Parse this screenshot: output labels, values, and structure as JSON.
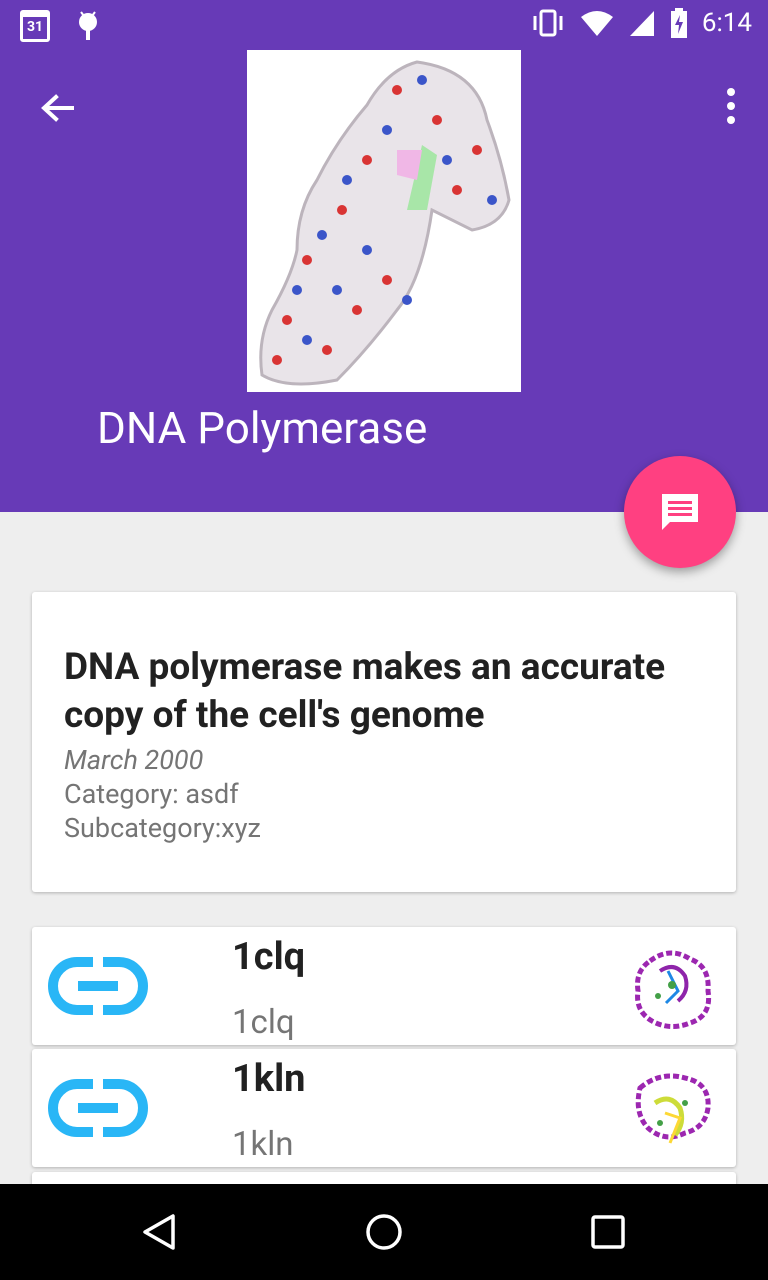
{
  "status_bar": {
    "time": "6:14",
    "calendar_day": "31"
  },
  "header": {
    "title": "DNA Polymerase"
  },
  "article": {
    "headline": "DNA polymerase makes an accurate copy of the cell's genome",
    "date": "March 2000",
    "category": "Category: asdf",
    "subcategory": "Subcategory:xyz"
  },
  "items": [
    {
      "name": "1clq",
      "subtitle": "1clq"
    },
    {
      "name": "1kln",
      "subtitle": "1kln"
    }
  ],
  "colors": {
    "primary": "#673ab7",
    "accent": "#ff4081",
    "link": "#29b6f6"
  },
  "icons": [
    "back-arrow-icon",
    "overflow-menu-icon",
    "comment-icon",
    "link-icon",
    "nav-back-icon",
    "nav-home-icon",
    "nav-recents-icon"
  ]
}
